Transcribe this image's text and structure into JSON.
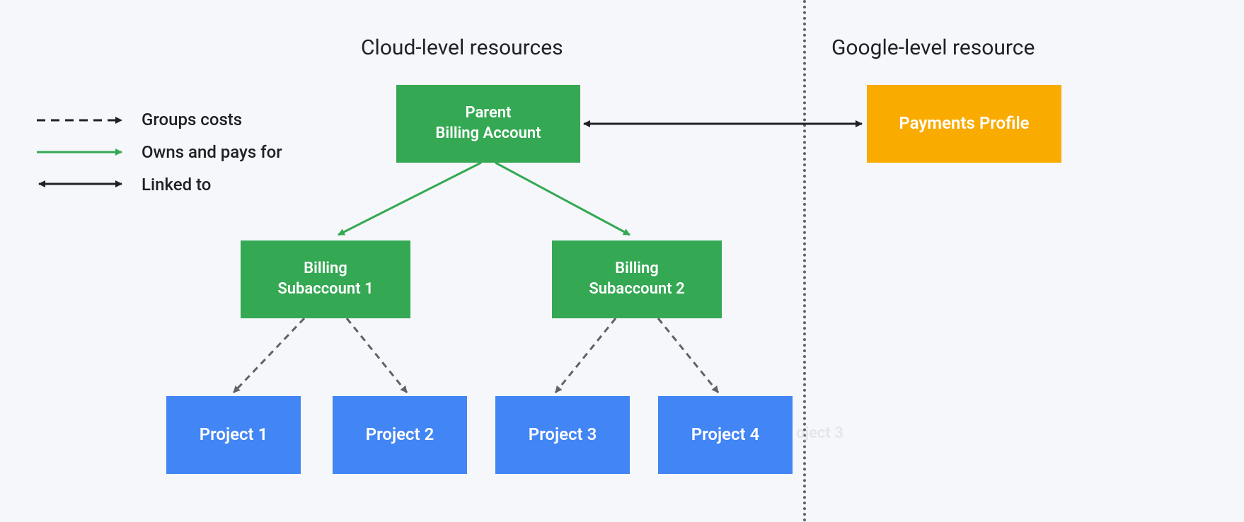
{
  "sections": {
    "cloud": "Cloud-level resources",
    "google": "Google-level resource"
  },
  "legend": {
    "groups_costs": "Groups costs",
    "owns_pays": "Owns and pays for",
    "linked_to": "Linked to"
  },
  "nodes": {
    "parent_billing_line1": "Parent",
    "parent_billing_line2": "Billing Account",
    "subaccount1_line1": "Billing",
    "subaccount1_line2": "Subaccount 1",
    "subaccount2_line1": "Billing",
    "subaccount2_line2": "Subaccount 2",
    "project1": "Project 1",
    "project2": "Project 2",
    "project3": "Project 3",
    "project4": "Project 4",
    "payments_profile": "Payments Profile",
    "ghost": "oject 3"
  },
  "colors": {
    "green": "#34a853",
    "blue": "#4285f4",
    "yellow": "#f9ab00",
    "text": "#202124",
    "gray": "#5f6368"
  }
}
